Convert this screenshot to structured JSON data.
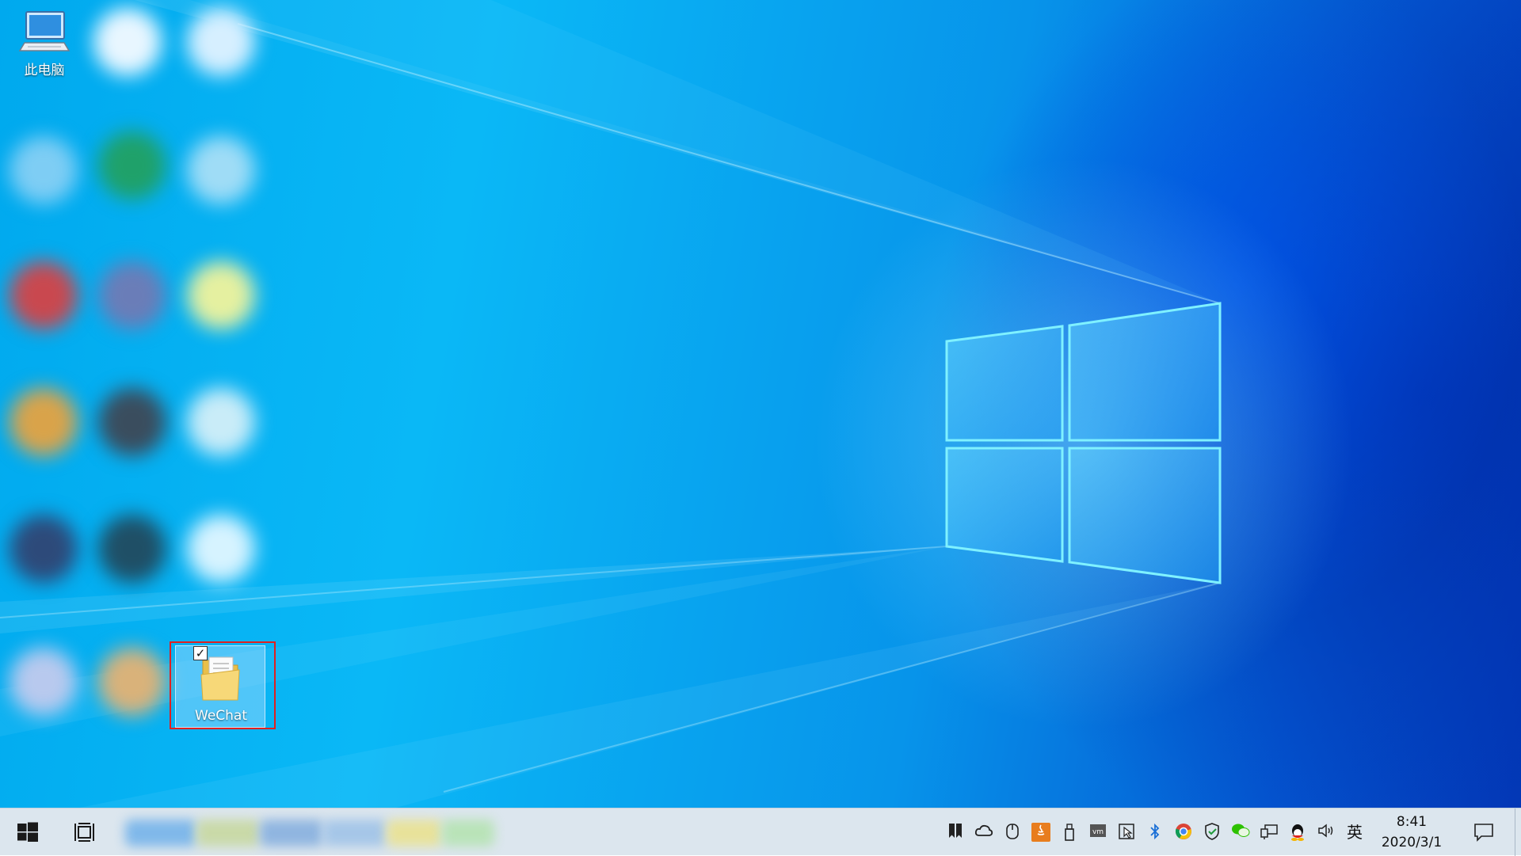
{
  "desktop": {
    "icons": [
      {
        "label": "此电脑",
        "icon": "this-pc-icon"
      },
      {
        "label": "WeChat",
        "icon": "folder-icon",
        "selected": true,
        "checked": true
      }
    ]
  },
  "taskbar": {
    "start_icon": "windows-logo-icon",
    "task_view_icon": "task-view-icon",
    "tray": {
      "input_language": "英",
      "time": "8:41",
      "date": "2020/3/1"
    }
  },
  "colors": {
    "desktop_light": "#0ab8f6",
    "desktop_dark": "#0339b8",
    "taskbar_bg": "#dce6ee",
    "highlight_border": "#e02020"
  }
}
